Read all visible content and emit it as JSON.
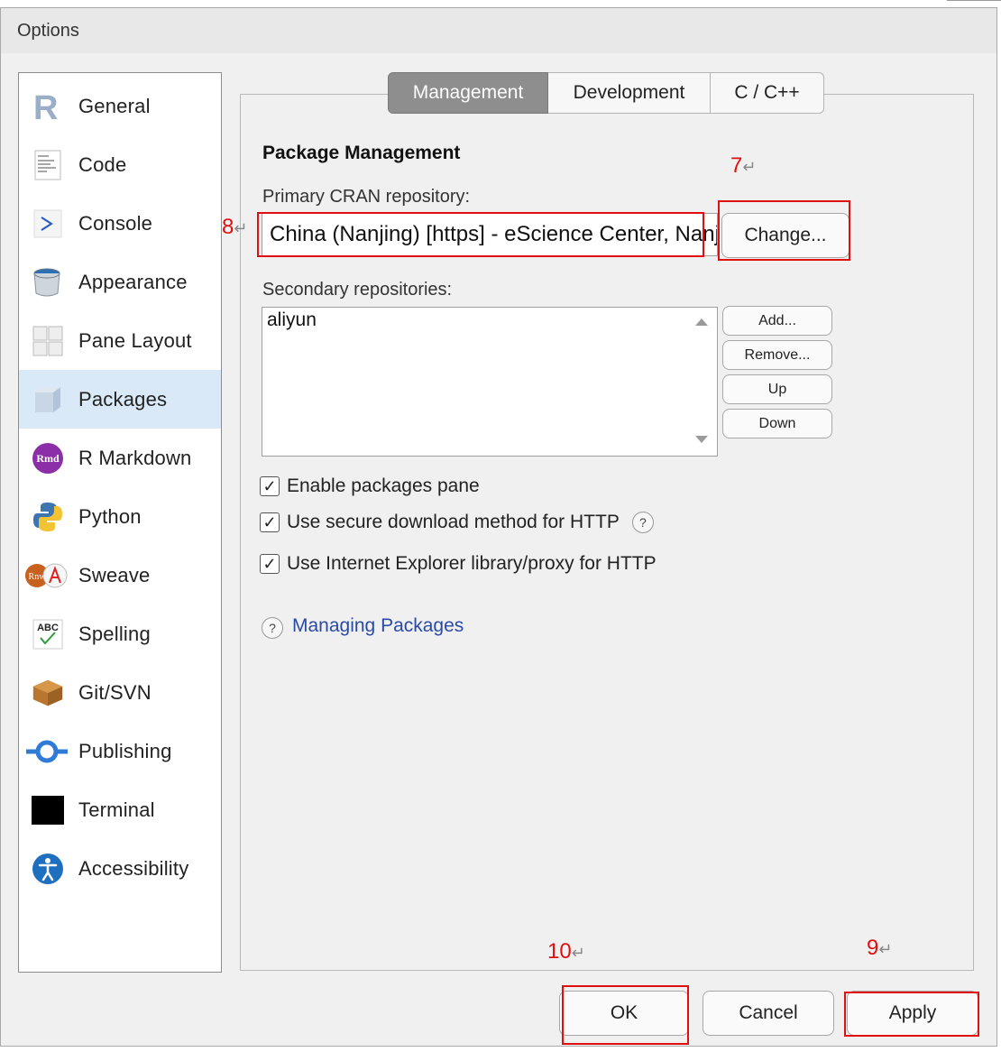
{
  "window": {
    "title": "Options"
  },
  "sidebar": {
    "items": [
      {
        "label": "General",
        "icon": "r-logo-icon"
      },
      {
        "label": "Code",
        "icon": "code-document-icon"
      },
      {
        "label": "Console",
        "icon": "console-prompt-icon"
      },
      {
        "label": "Appearance",
        "icon": "paint-bucket-icon"
      },
      {
        "label": "Pane Layout",
        "icon": "pane-grid-icon"
      },
      {
        "label": "Packages",
        "icon": "package-box-icon",
        "selected": true
      },
      {
        "label": "R Markdown",
        "icon": "rmd-icon"
      },
      {
        "label": "Python",
        "icon": "python-icon"
      },
      {
        "label": "Sweave",
        "icon": "sweave-icon"
      },
      {
        "label": "Spelling",
        "icon": "spelling-abc-icon"
      },
      {
        "label": "Git/SVN",
        "icon": "git-box-icon"
      },
      {
        "label": "Publishing",
        "icon": "publishing-icon"
      },
      {
        "label": "Terminal",
        "icon": "terminal-icon"
      },
      {
        "label": "Accessibility",
        "icon": "accessibility-icon"
      }
    ]
  },
  "tabs": [
    {
      "label": "Management",
      "active": true
    },
    {
      "label": "Development"
    },
    {
      "label": "C / C++"
    }
  ],
  "management": {
    "section_title": "Package Management",
    "primary_repo_label": "Primary CRAN repository:",
    "primary_repo_value": "China (Nanjing) [https] - eScience Center, Nanjing University",
    "change_button": "Change...",
    "secondary_label": "Secondary repositories:",
    "secondary_repos": [
      "aliyun"
    ],
    "add_button": "Add...",
    "remove_button": "Remove...",
    "up_button": "Up",
    "down_button": "Down",
    "checkboxes": [
      {
        "label": "Enable packages pane",
        "checked": true
      },
      {
        "label": "Use secure download method for HTTP",
        "checked": true,
        "help": true
      },
      {
        "label": "Use Internet Explorer library/proxy for HTTP",
        "checked": true
      }
    ],
    "help_link": "Managing Packages"
  },
  "footer": {
    "ok_button": "OK",
    "cancel_button": "Cancel",
    "apply_button": "Apply"
  },
  "annotations": {
    "n7": "7",
    "n8": "8",
    "n9": "9",
    "n10": "10",
    "return_glyph": "↵"
  },
  "colors": {
    "selection": "#d9e9f7",
    "active_tab": "#8e8e8e",
    "annotation_red": "#e01010",
    "link_blue": "#2a4aa8"
  }
}
